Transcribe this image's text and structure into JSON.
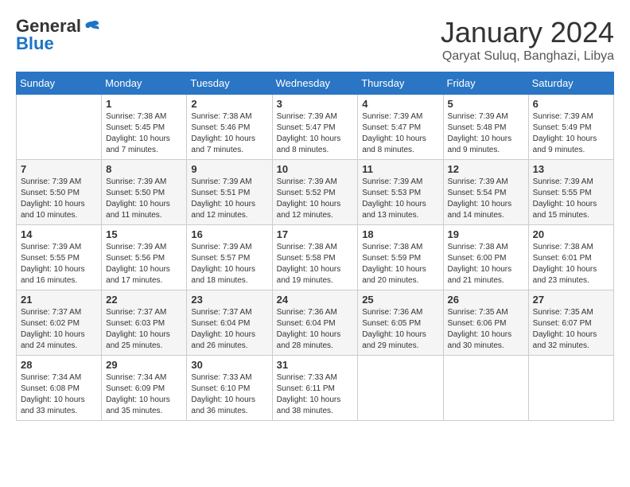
{
  "header": {
    "logo": {
      "general": "General",
      "blue": "Blue"
    },
    "title": "January 2024",
    "location": "Qaryat Suluq, Banghazi, Libya"
  },
  "weekdays": [
    "Sunday",
    "Monday",
    "Tuesday",
    "Wednesday",
    "Thursday",
    "Friday",
    "Saturday"
  ],
  "weeks": [
    [
      {
        "day": "",
        "info": ""
      },
      {
        "day": "1",
        "info": "Sunrise: 7:38 AM\nSunset: 5:45 PM\nDaylight: 10 hours\nand 7 minutes."
      },
      {
        "day": "2",
        "info": "Sunrise: 7:38 AM\nSunset: 5:46 PM\nDaylight: 10 hours\nand 7 minutes."
      },
      {
        "day": "3",
        "info": "Sunrise: 7:39 AM\nSunset: 5:47 PM\nDaylight: 10 hours\nand 8 minutes."
      },
      {
        "day": "4",
        "info": "Sunrise: 7:39 AM\nSunset: 5:47 PM\nDaylight: 10 hours\nand 8 minutes."
      },
      {
        "day": "5",
        "info": "Sunrise: 7:39 AM\nSunset: 5:48 PM\nDaylight: 10 hours\nand 9 minutes."
      },
      {
        "day": "6",
        "info": "Sunrise: 7:39 AM\nSunset: 5:49 PM\nDaylight: 10 hours\nand 9 minutes."
      }
    ],
    [
      {
        "day": "7",
        "info": "Sunrise: 7:39 AM\nSunset: 5:50 PM\nDaylight: 10 hours\nand 10 minutes."
      },
      {
        "day": "8",
        "info": "Sunrise: 7:39 AM\nSunset: 5:50 PM\nDaylight: 10 hours\nand 11 minutes."
      },
      {
        "day": "9",
        "info": "Sunrise: 7:39 AM\nSunset: 5:51 PM\nDaylight: 10 hours\nand 12 minutes."
      },
      {
        "day": "10",
        "info": "Sunrise: 7:39 AM\nSunset: 5:52 PM\nDaylight: 10 hours\nand 12 minutes."
      },
      {
        "day": "11",
        "info": "Sunrise: 7:39 AM\nSunset: 5:53 PM\nDaylight: 10 hours\nand 13 minutes."
      },
      {
        "day": "12",
        "info": "Sunrise: 7:39 AM\nSunset: 5:54 PM\nDaylight: 10 hours\nand 14 minutes."
      },
      {
        "day": "13",
        "info": "Sunrise: 7:39 AM\nSunset: 5:55 PM\nDaylight: 10 hours\nand 15 minutes."
      }
    ],
    [
      {
        "day": "14",
        "info": "Sunrise: 7:39 AM\nSunset: 5:55 PM\nDaylight: 10 hours\nand 16 minutes."
      },
      {
        "day": "15",
        "info": "Sunrise: 7:39 AM\nSunset: 5:56 PM\nDaylight: 10 hours\nand 17 minutes."
      },
      {
        "day": "16",
        "info": "Sunrise: 7:39 AM\nSunset: 5:57 PM\nDaylight: 10 hours\nand 18 minutes."
      },
      {
        "day": "17",
        "info": "Sunrise: 7:38 AM\nSunset: 5:58 PM\nDaylight: 10 hours\nand 19 minutes."
      },
      {
        "day": "18",
        "info": "Sunrise: 7:38 AM\nSunset: 5:59 PM\nDaylight: 10 hours\nand 20 minutes."
      },
      {
        "day": "19",
        "info": "Sunrise: 7:38 AM\nSunset: 6:00 PM\nDaylight: 10 hours\nand 21 minutes."
      },
      {
        "day": "20",
        "info": "Sunrise: 7:38 AM\nSunset: 6:01 PM\nDaylight: 10 hours\nand 23 minutes."
      }
    ],
    [
      {
        "day": "21",
        "info": "Sunrise: 7:37 AM\nSunset: 6:02 PM\nDaylight: 10 hours\nand 24 minutes."
      },
      {
        "day": "22",
        "info": "Sunrise: 7:37 AM\nSunset: 6:03 PM\nDaylight: 10 hours\nand 25 minutes."
      },
      {
        "day": "23",
        "info": "Sunrise: 7:37 AM\nSunset: 6:04 PM\nDaylight: 10 hours\nand 26 minutes."
      },
      {
        "day": "24",
        "info": "Sunrise: 7:36 AM\nSunset: 6:04 PM\nDaylight: 10 hours\nand 28 minutes."
      },
      {
        "day": "25",
        "info": "Sunrise: 7:36 AM\nSunset: 6:05 PM\nDaylight: 10 hours\nand 29 minutes."
      },
      {
        "day": "26",
        "info": "Sunrise: 7:35 AM\nSunset: 6:06 PM\nDaylight: 10 hours\nand 30 minutes."
      },
      {
        "day": "27",
        "info": "Sunrise: 7:35 AM\nSunset: 6:07 PM\nDaylight: 10 hours\nand 32 minutes."
      }
    ],
    [
      {
        "day": "28",
        "info": "Sunrise: 7:34 AM\nSunset: 6:08 PM\nDaylight: 10 hours\nand 33 minutes."
      },
      {
        "day": "29",
        "info": "Sunrise: 7:34 AM\nSunset: 6:09 PM\nDaylight: 10 hours\nand 35 minutes."
      },
      {
        "day": "30",
        "info": "Sunrise: 7:33 AM\nSunset: 6:10 PM\nDaylight: 10 hours\nand 36 minutes."
      },
      {
        "day": "31",
        "info": "Sunrise: 7:33 AM\nSunset: 6:11 PM\nDaylight: 10 hours\nand 38 minutes."
      },
      {
        "day": "",
        "info": ""
      },
      {
        "day": "",
        "info": ""
      },
      {
        "day": "",
        "info": ""
      }
    ]
  ]
}
